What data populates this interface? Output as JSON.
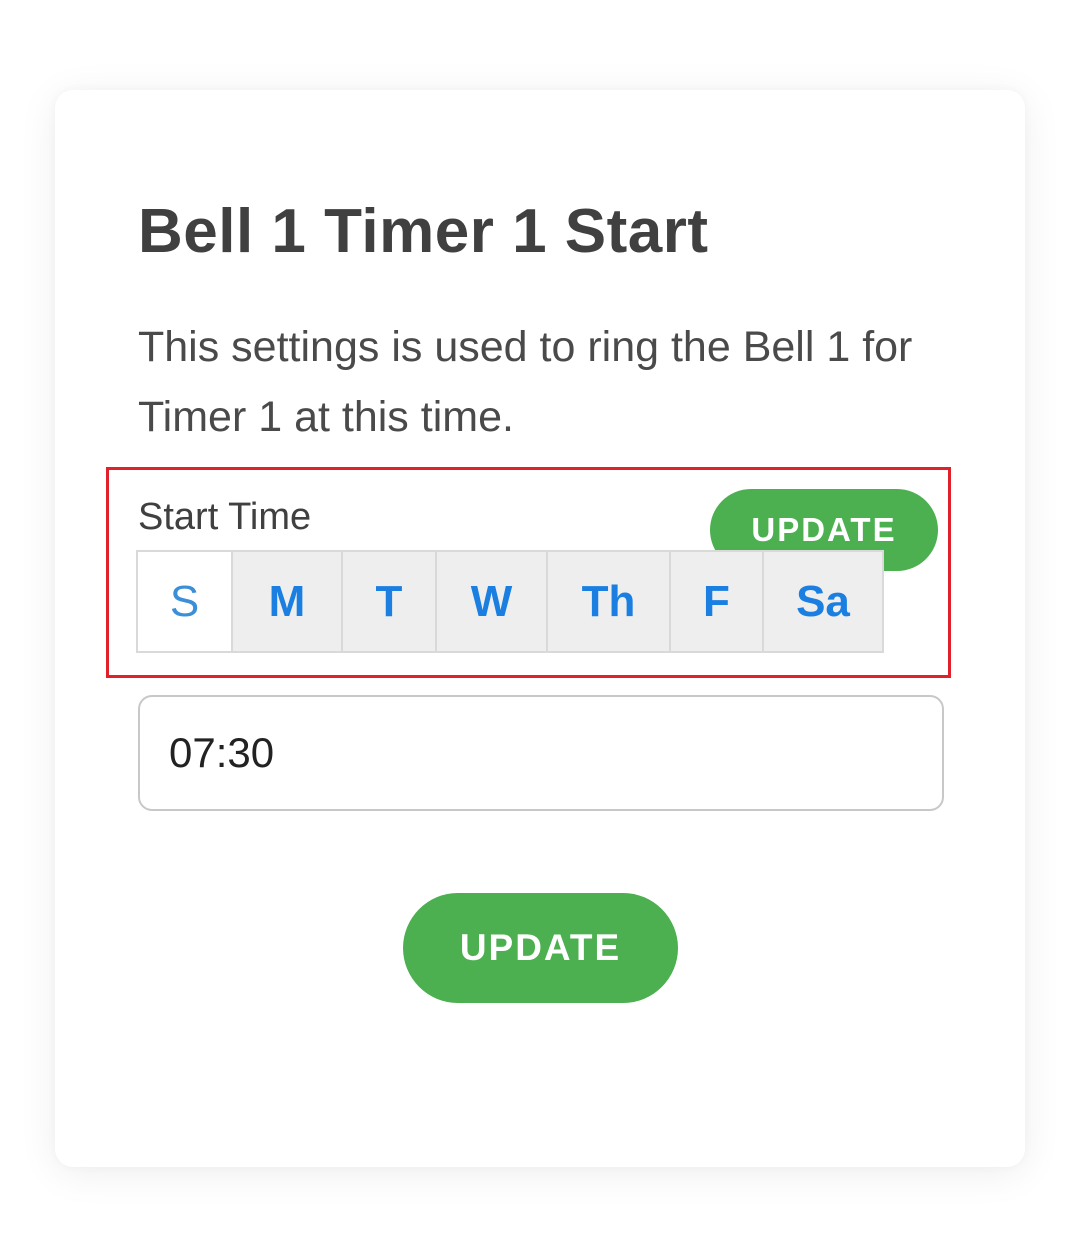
{
  "card": {
    "title": "Bell 1 Timer 1 Start",
    "description": "This settings is used to ring the Bell 1 for Timer 1 at this time."
  },
  "start_time": {
    "label": "Start Time",
    "update_label": "UPDATE",
    "days": [
      {
        "label": "S",
        "selected": false
      },
      {
        "label": "M",
        "selected": true
      },
      {
        "label": "T",
        "selected": true
      },
      {
        "label": "W",
        "selected": true
      },
      {
        "label": "Th",
        "selected": true
      },
      {
        "label": "F",
        "selected": true
      },
      {
        "label": "Sa",
        "selected": true
      }
    ],
    "time_value": "07:30"
  },
  "footer": {
    "update_label": "UPDATE"
  },
  "colors": {
    "accent_green": "#4caf50",
    "day_text_blue": "#1a7fe0",
    "highlight_red": "#e0212b",
    "title_text": "#404040"
  }
}
